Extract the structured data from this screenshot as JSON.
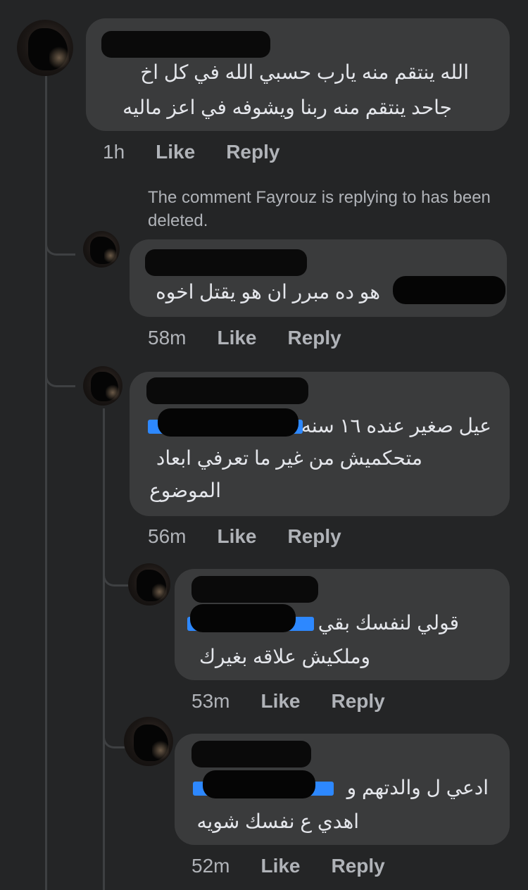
{
  "comments": [
    {
      "text_lines": [
        "الله ينتقم منه يارب حسبي الله في كل اخ",
        "جاحد ينتقم منه ربنا ويشوفه في اعز ماليه"
      ],
      "time": "1h",
      "like": "Like",
      "reply": "Reply"
    },
    {
      "text_lines": [
        "هو ده مبرر ان هو يقتل اخوه"
      ],
      "time": "58m",
      "like": "Like",
      "reply": "Reply"
    },
    {
      "text_lines": [
        "عيل صغير عنده ١٦ سنه",
        "متحكميش من غير ما تعرفي ابعاد",
        "الموضوع"
      ],
      "time": "56m",
      "like": "Like",
      "reply": "Reply"
    },
    {
      "text_lines": [
        "قولي لنفسك بقي",
        "وملكيش علاقه بغيرك"
      ],
      "time": "53m",
      "like": "Like",
      "reply": "Reply"
    },
    {
      "text_lines": [
        "ادعي ل والدتهم و",
        "اهدي ع نفسك شويه"
      ],
      "time": "52m",
      "like": "Like",
      "reply": "Reply"
    }
  ],
  "deleted_note": "The comment Fayrouz is replying to has been deleted.",
  "colors": {
    "background": "#242526",
    "bubble": "#3a3b3c",
    "text": "#e4e6eb",
    "secondary_text": "#b0b3b8",
    "mention": "#2d88ff"
  }
}
